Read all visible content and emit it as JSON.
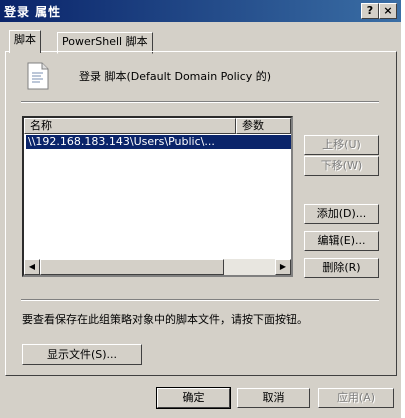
{
  "window": {
    "title": "登录 属性",
    "help_label": "?",
    "close_label": "×"
  },
  "tabs": [
    {
      "label": "脚本"
    },
    {
      "label": "PowerShell 脚本"
    }
  ],
  "heading": "登录 脚本(Default Domain Policy 的)",
  "list": {
    "columns": [
      "名称",
      "参数"
    ],
    "rows": [
      {
        "name": "\\\\192.168.183.143\\Users\\Public\\..."
      }
    ]
  },
  "side_buttons": {
    "up": "上移(U)",
    "down": "下移(W)",
    "add": "添加(D)...",
    "edit": "编辑(E)...",
    "remove": "删除(R)"
  },
  "info_text": "要查看保存在此组策略对象中的脚本文件，请按下面按钮。",
  "show_files": "显示文件(S)...",
  "footer": {
    "ok": "确定",
    "cancel": "取消",
    "apply": "应用(A)"
  }
}
